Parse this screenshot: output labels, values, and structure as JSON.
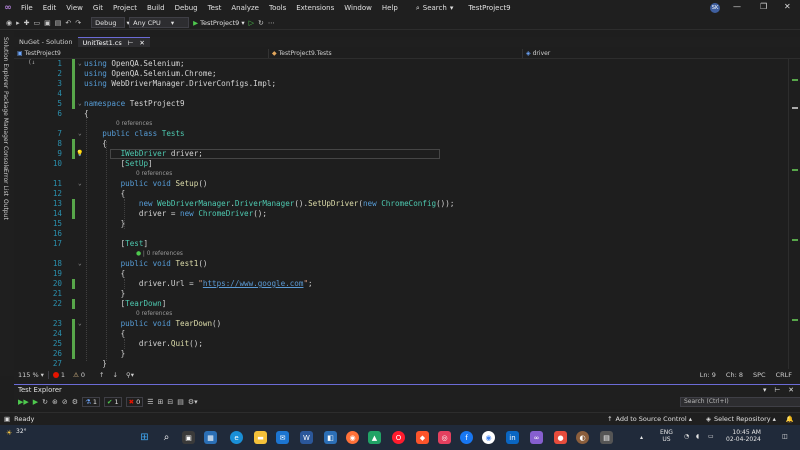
{
  "menubar": {
    "items": [
      "File",
      "Edit",
      "View",
      "Git",
      "Project",
      "Build",
      "Debug",
      "Test",
      "Analyze",
      "Tools",
      "Extensions",
      "Window",
      "Help"
    ],
    "search_label": "Search",
    "solution_title": "TestProject9",
    "user_initials": "SK"
  },
  "toolbar": {
    "config": "Debug",
    "platform": "Any CPU",
    "run_target": "TestProject9"
  },
  "left_rail": [
    "Solution Explorer",
    "Package Manager Console",
    "Error List",
    "Output"
  ],
  "doc_tabs": [
    {
      "label": "NuGet - Solution",
      "active": false
    },
    {
      "label": "UnitTest1.cs",
      "active": true
    }
  ],
  "navbar": {
    "project": "TestProject9",
    "class": "TestProject9.Tests",
    "member": "driver"
  },
  "code": {
    "line_numbers": [
      "1",
      "2",
      "3",
      "4",
      "5",
      "6",
      "7",
      "8",
      "9",
      "10",
      "11",
      "12",
      "13",
      "14",
      "15",
      "16",
      "17",
      "18",
      "19",
      "20",
      "21",
      "22",
      "23",
      "24",
      "25",
      "26",
      "27"
    ],
    "references_0": "0 references",
    "references_test": "| 0 references"
  },
  "editor_status": {
    "zoom": "115 %",
    "errors": "1",
    "warnings": "0",
    "line": "Ln: 9",
    "col": "Ch: 8",
    "spc": "SPC",
    "eol": "CRLF"
  },
  "test_explorer": {
    "title": "Test Explorer",
    "total": "1",
    "passed": "1",
    "failed": "0",
    "search_placeholder": "Search (Ctrl+I)"
  },
  "statusbar": {
    "ready": "Ready",
    "source_control": "Add to Source Control",
    "repo": "Select Repository"
  },
  "taskbar": {
    "weather": "32°",
    "lang_top": "ENG",
    "lang_bottom": "US",
    "time": "10:45 AM",
    "date": "02-04-2024"
  }
}
